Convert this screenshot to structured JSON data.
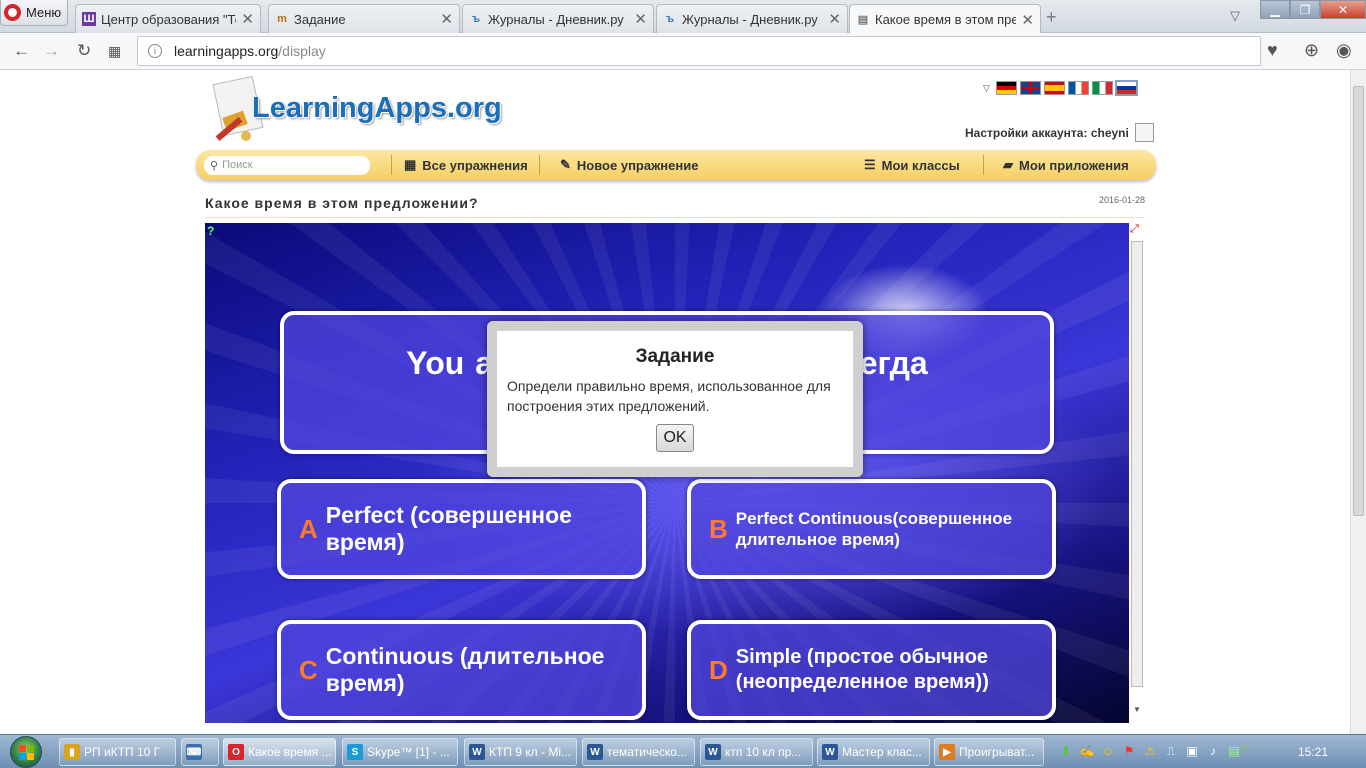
{
  "browser": {
    "menu_label": "Меню",
    "tabs": [
      {
        "title": "Центр образования \"Техн",
        "icon": "shi-icon"
      },
      {
        "title": "Задание",
        "icon": "learningapps-icon"
      },
      {
        "title": "Журналы - Дневник.ру",
        "icon": "dnevnik-icon"
      },
      {
        "title": "Журналы - Дневник.ру",
        "icon": "dnevnik-icon"
      },
      {
        "title": "Какое время в этом пред",
        "icon": "page-icon"
      }
    ],
    "url_host": "learningapps.org",
    "url_path": "/display"
  },
  "site": {
    "logo": "LearningApps.org",
    "account_label": "Настройки аккаунта:",
    "account_user": "cheyni",
    "search_placeholder": "Поиск",
    "nav": {
      "all": "Все упражнения",
      "new": "Новое упражнение",
      "classes": "Мои классы",
      "apps": "Мои приложения"
    },
    "page_title": "Какое время в этом предложении?",
    "page_date": "2016-01-28",
    "languages": [
      "de",
      "en",
      "es",
      "fr",
      "it",
      "ru"
    ]
  },
  "app": {
    "question_left": "You al",
    "question_right": "сегда",
    "answers": [
      {
        "letter": "A",
        "text": "Perfect (совершенное время)"
      },
      {
        "letter": "B",
        "text": "Perfect Continuous(совершенное длительное время)"
      },
      {
        "letter": "C",
        "text": "Continuous (длительное время)"
      },
      {
        "letter": "D",
        "text": "Simple (простое обычное (неопределенное время))"
      }
    ]
  },
  "dialog": {
    "title": "Задание",
    "body": "Определи правильно время, использованное для построения этих предложений.",
    "ok": "OK"
  },
  "taskbar": {
    "items": [
      {
        "label": "РП иКТП 10 Г",
        "color": "#d9a520",
        "glyph": "▮"
      },
      {
        "label": "",
        "color": "#3d6fb0",
        "glyph": "⌨"
      },
      {
        "label": "Какое время ...",
        "color": "#d8242b",
        "glyph": "O"
      },
      {
        "label": "Skype™ [1] - ...",
        "color": "#1a9bd8",
        "glyph": "S"
      },
      {
        "label": "КТП 9 кл - Mi...",
        "color": "#2b5797",
        "glyph": "W"
      },
      {
        "label": "тематическо...",
        "color": "#2b5797",
        "glyph": "W"
      },
      {
        "label": "ктп  10 кл пр...",
        "color": "#2b5797",
        "glyph": "W"
      },
      {
        "label": "Мастер клас...",
        "color": "#2b5797",
        "glyph": "W"
      },
      {
        "label": "Проигрыват...",
        "color": "#e07b20",
        "glyph": "▶"
      }
    ],
    "clock": "15:21"
  }
}
